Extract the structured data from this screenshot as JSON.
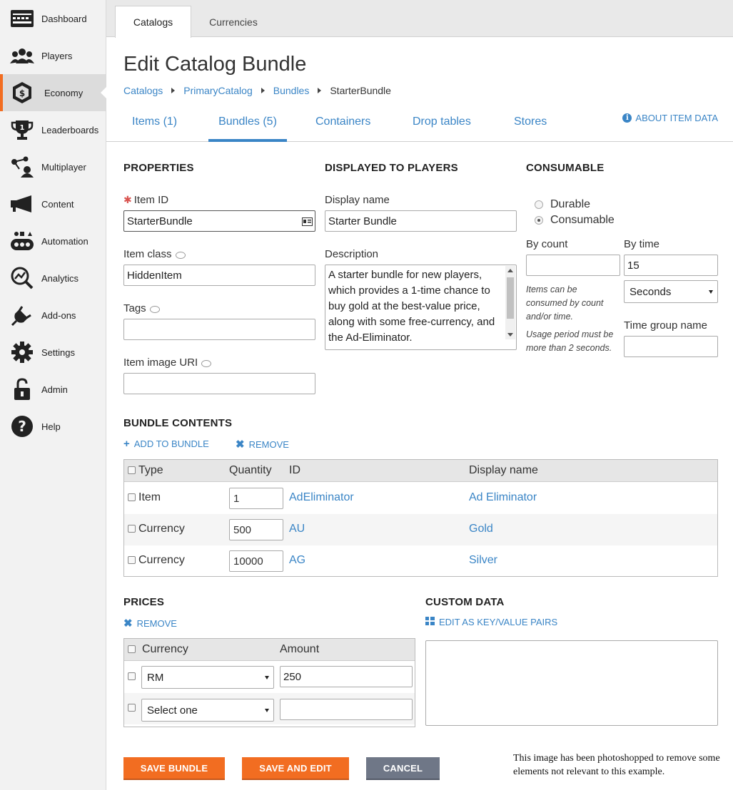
{
  "sidebar": {
    "items": [
      {
        "label": "Dashboard",
        "icon": "dashboard-icon"
      },
      {
        "label": "Players",
        "icon": "players-icon"
      },
      {
        "label": "Economy",
        "icon": "economy-icon"
      },
      {
        "label": "Leaderboards",
        "icon": "trophy-icon"
      },
      {
        "label": "Multiplayer",
        "icon": "multiplayer-icon"
      },
      {
        "label": "Content",
        "icon": "megaphone-icon"
      },
      {
        "label": "Automation",
        "icon": "automation-icon"
      },
      {
        "label": "Analytics",
        "icon": "analytics-icon"
      },
      {
        "label": "Add-ons",
        "icon": "plug-icon"
      },
      {
        "label": "Settings",
        "icon": "gear-icon"
      },
      {
        "label": "Admin",
        "icon": "lock-icon"
      },
      {
        "label": "Help",
        "icon": "help-icon"
      }
    ]
  },
  "top_tabs": [
    "Catalogs",
    "Currencies"
  ],
  "page_title": "Edit Catalog Bundle",
  "breadcrumb": [
    "Catalogs",
    "PrimaryCatalog",
    "Bundles",
    "StarterBundle"
  ],
  "sub_tabs": [
    "Items (1)",
    "Bundles (5)",
    "Containers",
    "Drop tables",
    "Stores"
  ],
  "about_link": "ABOUT ITEM DATA",
  "properties": {
    "title": "PROPERTIES",
    "item_id_label": "Item ID",
    "item_id": "StarterBundle",
    "item_class_label": "Item class",
    "item_class": "HiddenItem",
    "tags_label": "Tags",
    "tags": "",
    "image_uri_label": "Item image URI",
    "image_uri": ""
  },
  "displayed": {
    "title": "DISPLAYED TO PLAYERS",
    "display_name_label": "Display name",
    "display_name": "Starter Bundle",
    "description_label": "Description",
    "description": "A starter bundle for new players, which provides a 1-time chance to buy gold at the best-value price, along with some free-currency, and the Ad-Eliminator."
  },
  "consumable": {
    "title": "CONSUMABLE",
    "options": [
      "Durable",
      "Consumable"
    ],
    "selected": "Consumable",
    "by_count_label": "By count",
    "by_count": "",
    "by_time_label": "By time",
    "by_time": "15",
    "time_unit": "Seconds",
    "note1": "Items can be consumed by count and/or time.",
    "note2": "Usage period must be more than 2 seconds.",
    "time_group_label": "Time group name",
    "time_group": ""
  },
  "bundle": {
    "title": "BUNDLE CONTENTS",
    "add_label": "ADD TO BUNDLE",
    "remove_label": "REMOVE",
    "headers": [
      "Type",
      "Quantity",
      "ID",
      "Display name"
    ],
    "rows": [
      {
        "type": "Item",
        "qty": "1",
        "id": "AdEliminator",
        "name": "Ad Eliminator"
      },
      {
        "type": "Currency",
        "qty": "500",
        "id": "AU",
        "name": "Gold"
      },
      {
        "type": "Currency",
        "qty": "10000",
        "id": "AG",
        "name": "Silver"
      }
    ]
  },
  "prices": {
    "title": "PRICES",
    "remove_label": "REMOVE",
    "headers": [
      "Currency",
      "Amount"
    ],
    "rows": [
      {
        "currency": "RM",
        "amount": "250"
      },
      {
        "currency": "Select one",
        "amount": ""
      }
    ]
  },
  "custom": {
    "title": "CUSTOM DATA",
    "edit_label": "EDIT AS KEY/VALUE PAIRS",
    "value": ""
  },
  "buttons": {
    "save": "SAVE BUNDLE",
    "save_edit": "SAVE AND EDIT",
    "cancel": "CANCEL"
  },
  "footnote": "This image has been photoshopped to remove some elements not relevant to this example.",
  "colors": {
    "accent": "#f26d21",
    "link": "#3a85c6",
    "cancel": "#6f7787"
  }
}
